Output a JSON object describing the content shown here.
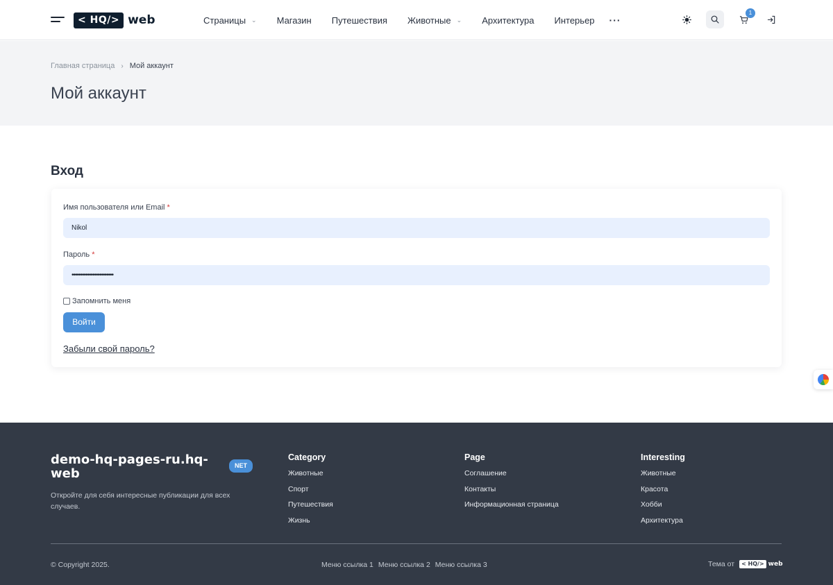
{
  "header": {
    "logo_tag": "< HQ/>",
    "logo_word": "web",
    "nav": [
      {
        "label": "Страницы",
        "dropdown": true
      },
      {
        "label": "Магазин",
        "dropdown": false
      },
      {
        "label": "Путешествия",
        "dropdown": false
      },
      {
        "label": "Животные",
        "dropdown": true
      },
      {
        "label": "Архитектура",
        "dropdown": false
      },
      {
        "label": "Интерьер",
        "dropdown": false
      }
    ],
    "more": "···",
    "cart_count": "1",
    "icons": [
      "menu-icon",
      "theme-toggle-icon",
      "search-icon",
      "cart-icon",
      "login-icon"
    ]
  },
  "breadcrumb": {
    "home": "Главная страница",
    "current": "Мой аккаунт"
  },
  "page_title": "Мой аккаунт",
  "login": {
    "heading": "Вход",
    "username_label": "Имя пользователя или Email",
    "username_value": "Nikol",
    "password_label": "Пароль",
    "password_value": "••••••••••••••••••••••••",
    "required_mark": "*",
    "remember_label": "Запомнить меня",
    "remember_checked": false,
    "submit_label": "Войти",
    "forgot_label": "Забыли свой пароль?"
  },
  "footer": {
    "brand": "demo-hq-pages-ru.hq-web",
    "badge": "NET",
    "description": "Откройте для себя интересные публикации для всех случаев.",
    "columns": [
      {
        "title": "Category",
        "links": [
          "Животные",
          "Спорт",
          "Путешествия",
          "Жизнь"
        ]
      },
      {
        "title": "Page",
        "links": [
          "Соглашение",
          "Контакты",
          "Информационная страница"
        ]
      },
      {
        "title": "Interesting",
        "links": [
          "Животные",
          "Красота",
          "Хобби",
          "Архитектура"
        ]
      }
    ],
    "copyright": "© Copyright 2025.",
    "menu_links": [
      "Меню ссылка 1",
      "Меню ссылка 2",
      "Меню ссылка 3"
    ],
    "theme_by": "Тема от",
    "theme_logo_tag": "< HQ/>",
    "theme_logo_word": "web"
  },
  "colors": {
    "accent": "#4a90d9",
    "footer_bg": "#333a46",
    "band_bg": "#f3f4f6",
    "input_bg": "#e8f0fe",
    "logo_bg": "#0f1e2e"
  }
}
